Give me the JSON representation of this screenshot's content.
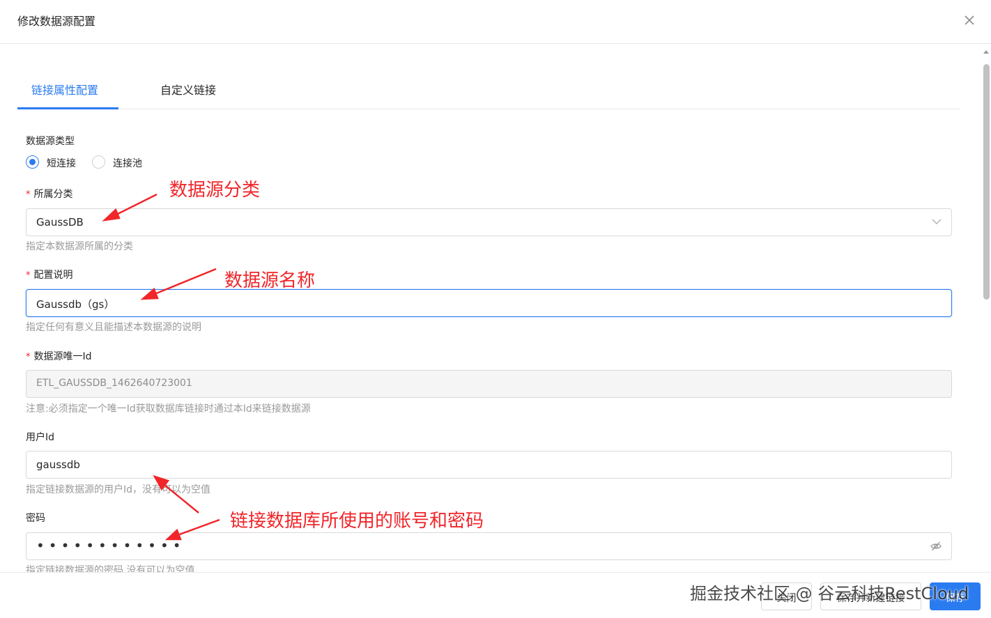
{
  "dialog": {
    "title": "修改数据源配置",
    "close_icon": "close-icon"
  },
  "tabs": [
    {
      "label": "链接属性配置",
      "active": true
    },
    {
      "label": "自定义链接",
      "active": false
    }
  ],
  "form": {
    "ds_type": {
      "label": "数据源类型",
      "options": [
        "短连接",
        "连接池"
      ],
      "selected": "短连接"
    },
    "category": {
      "label": "所属分类",
      "value": "GaussDB",
      "help": "指定本数据源所属的分类"
    },
    "desc": {
      "label": "配置说明",
      "value": "Gaussdb（gs）",
      "help": "指定任何有意义且能描述本数据源的说明"
    },
    "ds_id": {
      "label": "数据源唯一Id",
      "value": "ETL_GAUSSDB_1462640723001",
      "help": "注意:必须指定一个唯一Id获取数据库链接时通过本Id来链接数据源"
    },
    "user_id": {
      "label": "用户Id",
      "value": "gaussdb",
      "help": "指定链接数据源的用户Id，没有可以为空值"
    },
    "password": {
      "label": "密码",
      "value_masked": "••••••••••••",
      "help": "指定链接数据源的密码,没有可以为空值"
    },
    "required_mark": "*"
  },
  "annotations": {
    "a1": "数据源分类",
    "a2": "数据源名称",
    "a3": "链接数据库所使用的账号和密码",
    "color": "#f0262a"
  },
  "footer": {
    "close_label": "关闭",
    "save_new_label": "保存并新建链接",
    "save_label": "保存"
  },
  "watermark": "掘金技术社区 @ 谷云科技RestCloud",
  "colors": {
    "accent": "#2b7bf0",
    "required": "#f5222d",
    "help": "#9a9a9a"
  }
}
